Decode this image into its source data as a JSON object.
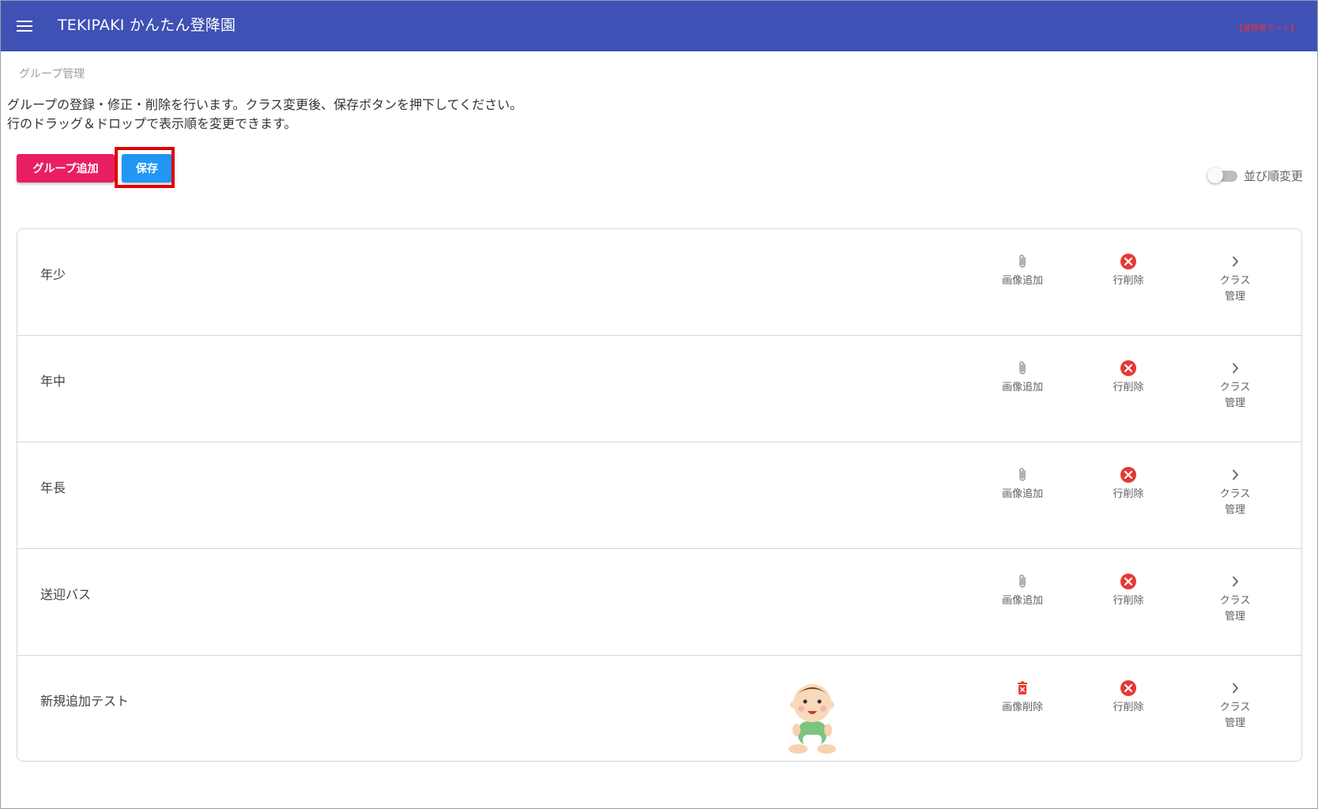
{
  "appbar": {
    "title": "TEKIPAKI かんたん登降園",
    "mode_label": "【管理者モード】"
  },
  "breadcrumb": "グループ管理",
  "description": {
    "line1": "グループの登録・修正・削除を行います。クラス変更後、保存ボタンを押下してください。",
    "line2": "行のドラッグ＆ドロップで表示順を変更できます。"
  },
  "toolbar": {
    "add_group_label": "グループ追加",
    "save_label": "保存"
  },
  "sort_toggle": {
    "label": "並び順変更",
    "checked": false
  },
  "actions": {
    "add_image": "画像追加",
    "delete_image": "画像削除",
    "delete_row": "行削除",
    "class_mgmt_line1": "クラス",
    "class_mgmt_line2": "管理"
  },
  "groups": [
    {
      "name": "年少",
      "has_image": false
    },
    {
      "name": "年中",
      "has_image": false
    },
    {
      "name": "年長",
      "has_image": false
    },
    {
      "name": "送迎バス",
      "has_image": false
    },
    {
      "name": "新規追加テスト",
      "has_image": true
    }
  ],
  "colors": {
    "appbar": "#3f51b5",
    "add_button": "#e91e63",
    "save_button": "#2196f3",
    "delete_icon": "#e53935",
    "highlight": "#e00000"
  },
  "icons": {
    "menu": "hamburger-menu-icon",
    "add_image": "paperclip-icon",
    "delete_image": "trash-icon",
    "delete_row": "cancel-circle-icon",
    "class_mgmt": "chevron-right-icon"
  }
}
